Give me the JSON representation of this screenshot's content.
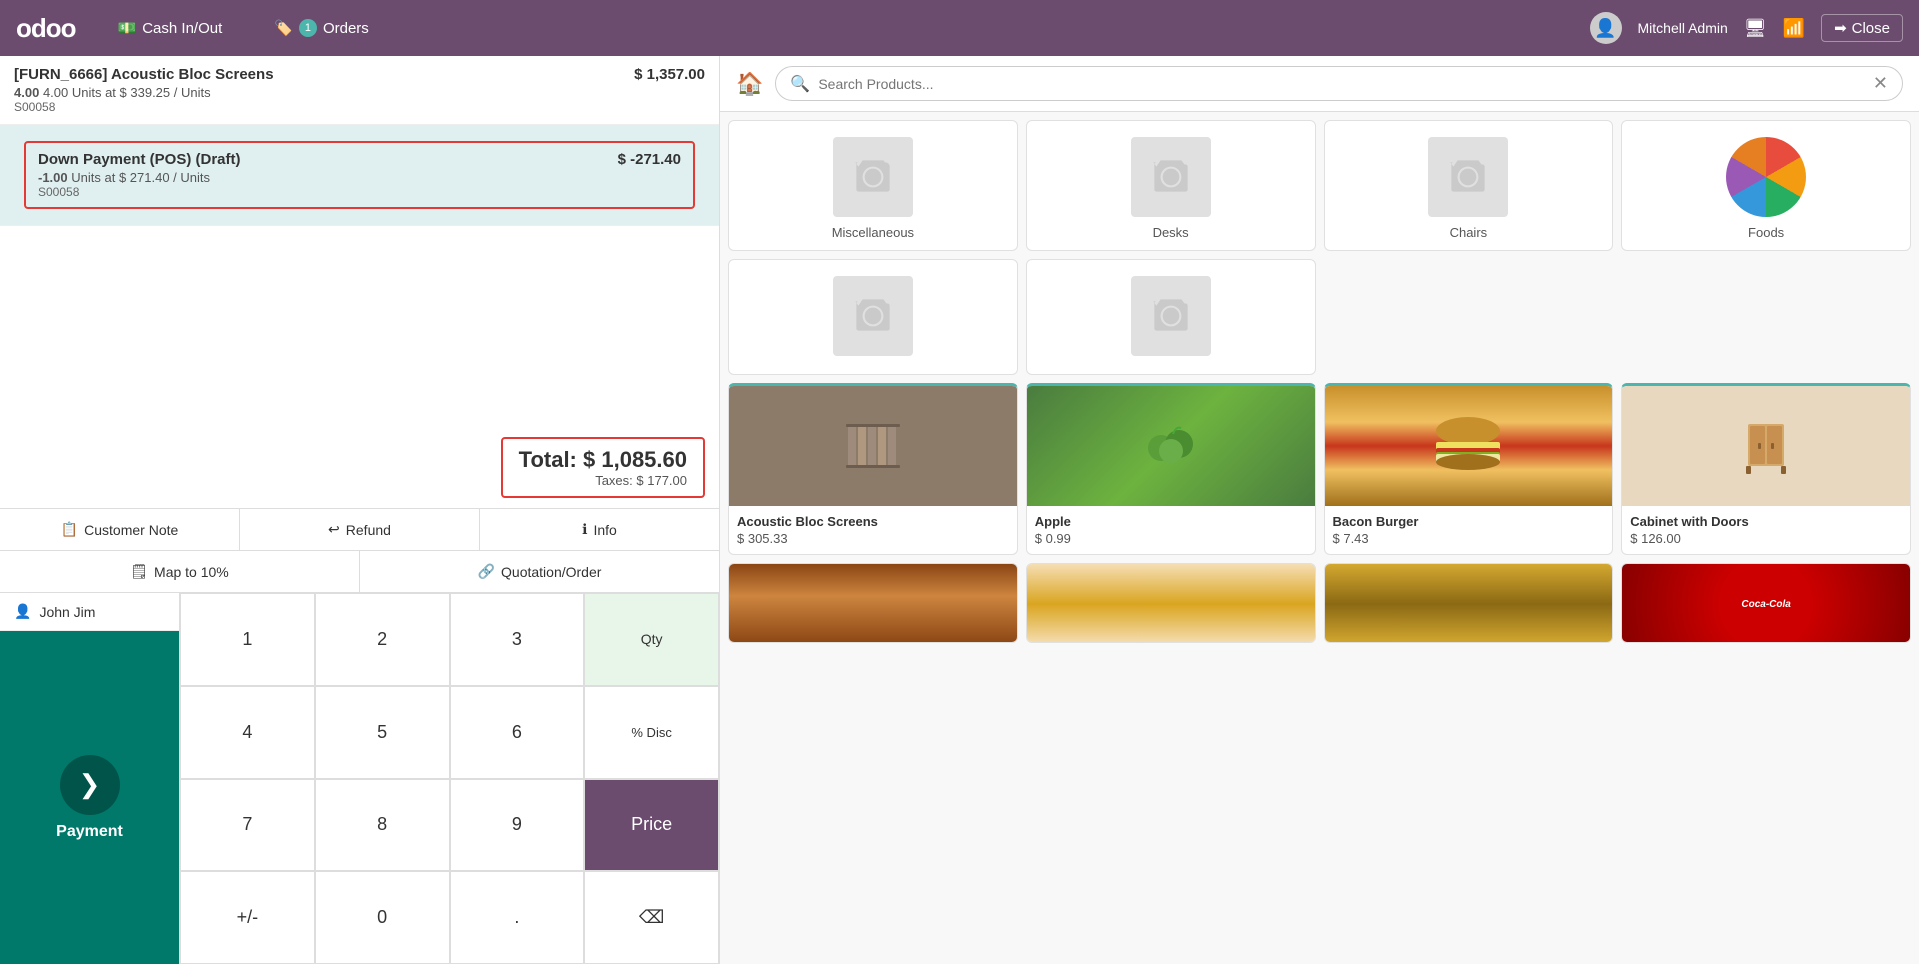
{
  "topnav": {
    "logo": "odoo",
    "cash_label": "Cash In/Out",
    "orders_label": "Orders",
    "orders_badge": "1",
    "user_name": "Mitchell Admin",
    "close_label": "Close"
  },
  "order": {
    "line1": {
      "name": "[FURN_6666] Acoustic Bloc Screens",
      "price": "$ 1,357.00",
      "detail": "4.00 Units at $ 339.25 / Units",
      "so": "S00058"
    },
    "line2": {
      "name": "Down Payment (POS) (Draft)",
      "price": "$ -271.40",
      "detail_prefix": "-1.00",
      "detail_rest": "Units at $ 271.40 / Units",
      "so": "S00058"
    },
    "total_label": "Total:",
    "total_amount": "$ 1,085.60",
    "taxes_label": "Taxes:",
    "taxes_amount": "$ 177.00"
  },
  "actions": {
    "customer_note": "Customer Note",
    "refund": "Refund",
    "info": "Info",
    "map_10": "Map to 10%",
    "quotation": "Quotation/Order"
  },
  "customer": {
    "name": "John Jim"
  },
  "numpad": {
    "keys": [
      [
        "1",
        "2",
        "3"
      ],
      [
        "4",
        "5",
        "6"
      ],
      [
        "7",
        "8",
        "9"
      ],
      [
        "+/-",
        "0",
        "."
      ]
    ],
    "qty_label": "Qty",
    "disc_label": "% Disc",
    "price_label": "Price"
  },
  "payment": {
    "label": "Payment"
  },
  "search": {
    "placeholder": "Search Products...",
    "clear": "✕"
  },
  "categories": [
    {
      "id": "miscellaneous",
      "name": "Miscellaneous",
      "has_image": false
    },
    {
      "id": "desks",
      "name": "Desks",
      "has_image": false
    },
    {
      "id": "chairs",
      "name": "Chairs",
      "has_image": false
    },
    {
      "id": "foods",
      "name": "Foods",
      "has_image": true
    }
  ],
  "products": [
    {
      "id": "acoustic",
      "name": "Acoustic Bloc Screens",
      "price": "$ 305.33",
      "has_image": true,
      "img_type": "acoustic"
    },
    {
      "id": "apple",
      "name": "Apple",
      "price": "$ 0.99",
      "has_image": true,
      "img_type": "apple"
    },
    {
      "id": "bacon-burger",
      "name": "Bacon Burger",
      "price": "$ 7.43",
      "has_image": true,
      "img_type": "burger"
    },
    {
      "id": "cabinet",
      "name": "Cabinet with Doors",
      "price": "$ 126.00",
      "has_image": true,
      "img_type": "cabinet"
    }
  ],
  "products_row2": [
    {
      "id": "burger2",
      "name": "",
      "price": "",
      "has_image": true,
      "img_type": "burger2"
    },
    {
      "id": "sandwich",
      "name": "",
      "price": "",
      "has_image": true,
      "img_type": "sandwich"
    },
    {
      "id": "bread",
      "name": "",
      "price": "",
      "has_image": true,
      "img_type": "bread"
    },
    {
      "id": "coca",
      "name": "",
      "price": "",
      "has_image": true,
      "img_type": "coca"
    }
  ]
}
